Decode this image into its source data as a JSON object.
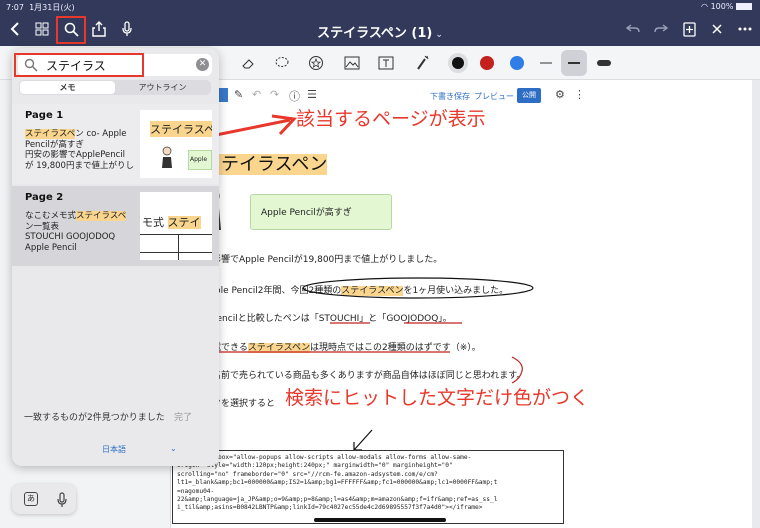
{
  "status": {
    "time": "7:07",
    "date": "1月31日(火)",
    "battery": "100%"
  },
  "app": {
    "title": "ステイラスペン (1)"
  },
  "search": {
    "query": "ステイラス",
    "tabs": [
      "メモ",
      "アウトライン"
    ]
  },
  "results": [
    {
      "page": "Page 1",
      "snippet_hl": "ステイラスペ",
      "snippet_line1": "ン co- Apple",
      "snippet_rest": [
        "Pencilが高すぎ",
        "円安の影響でApplePencil",
        "が 19,800円まで値上がりし"
      ],
      "thumb_title": "ステイラスペ",
      "thumb_note": "Apple"
    },
    {
      "page": "Page 2",
      "snippet_pre": "なこむメモ式",
      "snippet_hl": "ステイラスペ",
      "snippet_rest": [
        "ン一覧表",
        "STOUCHI GOOJODOQ",
        "Apple Pencil"
      ],
      "thumb_pre": "モ式 ",
      "thumb_hl": "ステイ"
    }
  ],
  "found_text": "一致するものが2件見つかりました",
  "done_label": "完了",
  "language": "日本語",
  "wp": {
    "draft": "下書き保存",
    "preview": "プレビュー",
    "publish": "公開"
  },
  "article": {
    "title_hl": "ステイラスペン",
    "bubble": "Apple Pencilが高すぎ",
    "line1": "の影響でApple Pencilが19,800円まで値上がりしました。",
    "line2_pre": "Apple Pencil2年間、",
    "line2_mid": "今回2種類の",
    "line2_hl": "ステイラスペン",
    "line2_post": "を1ヶ月使い込みました。",
    "line3_pre": "e Pencilと比較したペンは「",
    "line3_a": "STOUCHI",
    "line3_mid": "」と「",
    "line3_b": "GOOJODOQ",
    "line3_post": "」。",
    "line4_pre": "充電できる",
    "line4_hl": "ステイラスペン",
    "line4_post": "は現時点ではこの2種類のはずです（※）。",
    "line5": "の名前で売られている商品も多くありますが商品自体はほぼ同じと思われます。",
    "line6": "ックを選択すると",
    "code": "iframe sandbox=\"allow-popups allow-scripts allow-modals allow-forms allow-same-\norigin\" style=\"width:120px;height:240px;\" marginwidth=\"0\" marginheight=\"0\"\nscrolling=\"no\" frameborder=\"0\" src=\"//rcm-fe.amazon-adsystem.com/e/cm?\nlt1=_blank&amp;bc1=000000&amp;IS2=1&amp;bg1=FFFFFF&amp;fc1=000000&amp;lc1=0000FF&amp;t\n=nagomu04-\n22&amp;language=ja_JP&amp;o=9&amp;p=8&amp;l=as4&amp;m=amazon&amp;f=ifr&amp;ref=as_ss_l\ni_til&amp;asins=B0842LBNTP&amp;linkId=79c4027ec55de4c2d69895557f3f7a4d0\"></iframe>"
  },
  "annotations": {
    "page_shown": "該当するページが表示",
    "hit_colored": "検索にヒットした文字だけ色がつく"
  },
  "keyboard": {
    "kana": "あ"
  },
  "colors": {
    "nav": "#33395a",
    "accent": "#e8382c",
    "highlight": "#f9d58e",
    "link": "#2d6dc4"
  }
}
